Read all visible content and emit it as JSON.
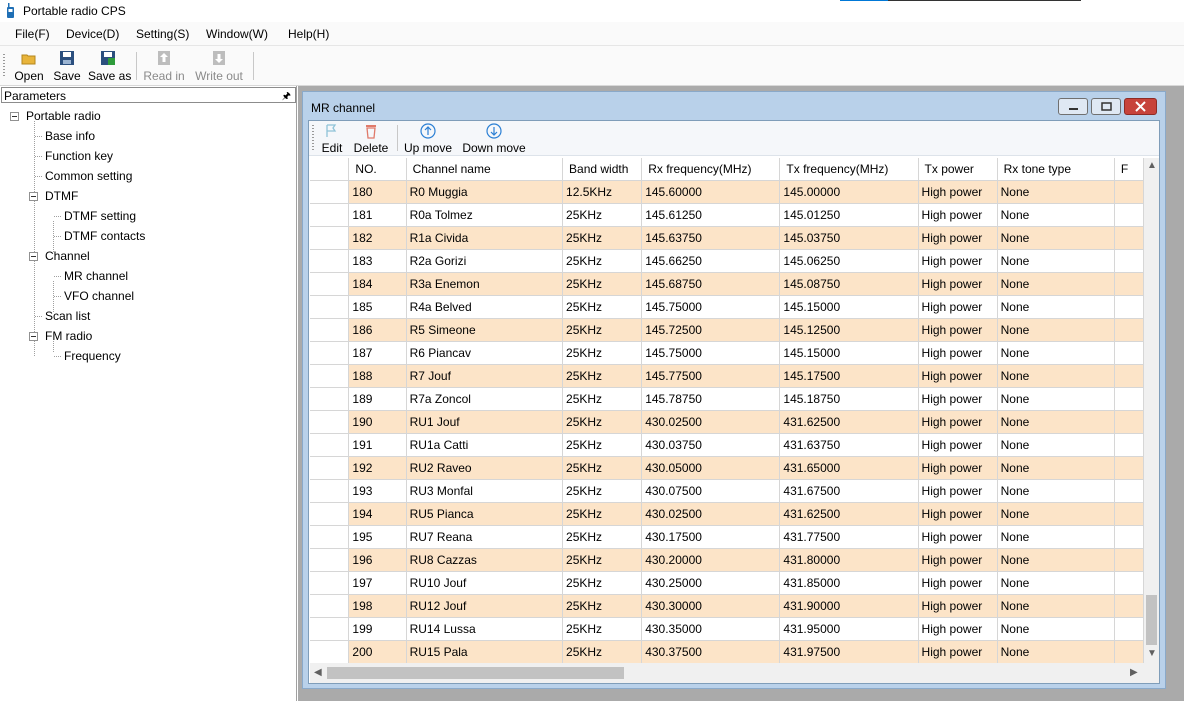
{
  "app": {
    "title": "Portable radio CPS"
  },
  "menu": [
    "File(F)",
    "Device(D)",
    "Setting(S)",
    "Window(W)",
    "Help(H)"
  ],
  "toolbar": {
    "open": "Open",
    "save": "Save",
    "save_as": "Save as",
    "read_in": "Read in",
    "write_out": "Write out"
  },
  "parameters": {
    "header": "Parameters",
    "tree": {
      "root": "Portable radio",
      "base_info": "Base info",
      "function_key": "Function key",
      "common_setting": "Common setting",
      "dtmf": "DTMF",
      "dtmf_setting": "DTMF setting",
      "dtmf_contacts": "DTMF contacts",
      "channel": "Channel",
      "mr_channel": "MR channel",
      "vfo_channel": "VFO channel",
      "scan_list": "Scan list",
      "fm_radio": "FM radio",
      "frequency": "Frequency"
    }
  },
  "mr_window": {
    "title": "MR channel",
    "actions": {
      "edit": "Edit",
      "delete": "Delete",
      "up_move": "Up move",
      "down_move": "Down move"
    },
    "columns": [
      "NO.",
      "Channel name",
      "Band width",
      "Rx frequency(MHz)",
      "Tx frequency(MHz)",
      "Tx power",
      "Rx tone type",
      "F"
    ],
    "rows": [
      [
        "180",
        "R0 Muggia",
        "12.5KHz",
        "145.60000",
        "145.00000",
        "High power",
        "None"
      ],
      [
        "181",
        "R0a Tolmez",
        "25KHz",
        "145.61250",
        "145.01250",
        "High power",
        "None"
      ],
      [
        "182",
        "R1a Civida",
        "25KHz",
        "145.63750",
        "145.03750",
        "High power",
        "None"
      ],
      [
        "183",
        "R2a Gorizi",
        "25KHz",
        "145.66250",
        "145.06250",
        "High power",
        "None"
      ],
      [
        "184",
        "R3a Enemon",
        "25KHz",
        "145.68750",
        "145.08750",
        "High power",
        "None"
      ],
      [
        "185",
        "R4a Belved",
        "25KHz",
        "145.75000",
        "145.15000",
        "High power",
        "None"
      ],
      [
        "186",
        "R5 Simeone",
        "25KHz",
        "145.72500",
        "145.12500",
        "High power",
        "None"
      ],
      [
        "187",
        "R6 Piancav",
        "25KHz",
        "145.75000",
        "145.15000",
        "High power",
        "None"
      ],
      [
        "188",
        "R7 Jouf",
        "25KHz",
        "145.77500",
        "145.17500",
        "High power",
        "None"
      ],
      [
        "189",
        "R7a Zoncol",
        "25KHz",
        "145.78750",
        "145.18750",
        "High power",
        "None"
      ],
      [
        "190",
        "RU1 Jouf",
        "25KHz",
        "430.02500",
        "431.62500",
        "High power",
        "None"
      ],
      [
        "191",
        "RU1a Catti",
        "25KHz",
        "430.03750",
        "431.63750",
        "High power",
        "None"
      ],
      [
        "192",
        "RU2 Raveo",
        "25KHz",
        "430.05000",
        "431.65000",
        "High power",
        "None"
      ],
      [
        "193",
        "RU3 Monfal",
        "25KHz",
        "430.07500",
        "431.67500",
        "High power",
        "None"
      ],
      [
        "194",
        "RU5 Pianca",
        "25KHz",
        "430.02500",
        "431.62500",
        "High power",
        "None"
      ],
      [
        "195",
        "RU7 Reana",
        "25KHz",
        "430.17500",
        "431.77500",
        "High power",
        "None"
      ],
      [
        "196",
        "RU8 Cazzas",
        "25KHz",
        "430.20000",
        "431.80000",
        "High power",
        "None"
      ],
      [
        "197",
        "RU10 Jouf",
        "25KHz",
        "430.25000",
        "431.85000",
        "High power",
        "None"
      ],
      [
        "198",
        "RU12 Jouf",
        "25KHz",
        "430.30000",
        "431.90000",
        "High power",
        "None"
      ],
      [
        "199",
        "RU14 Lussa",
        "25KHz",
        "430.35000",
        "431.95000",
        "High power",
        "None"
      ],
      [
        "200",
        "RU15 Pala",
        "25KHz",
        "430.37500",
        "431.97500",
        "High power",
        "None"
      ]
    ]
  },
  "colors": {
    "row_alt": "#fce4c8",
    "mdi_frame": "#b9d1ea",
    "close_btn": "#c7433b",
    "icon_blue": "#2a7fd4"
  }
}
